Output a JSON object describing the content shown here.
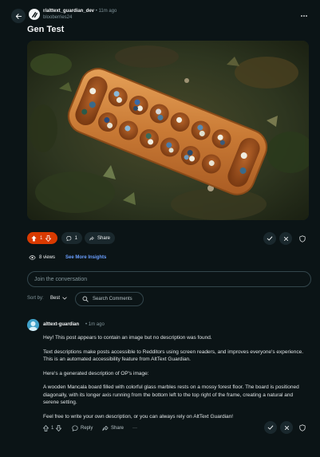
{
  "header": {
    "subreddit": "r/alttext_guardian_dev",
    "time": "• 11m ago",
    "author": "blooberries24"
  },
  "post": {
    "title": "Gen Test",
    "image_alt": "Wooden Mancala board with glass marbles on a mossy forest floor"
  },
  "post_actions": {
    "votes": "1",
    "comments": "1",
    "share_label": "Share"
  },
  "stats": {
    "views": "8 views",
    "insights_label": "See More Insights"
  },
  "join": {
    "placeholder": "Join the conversation"
  },
  "sort": {
    "label": "Sort by:",
    "value": "Best",
    "search_label": "Search Comments"
  },
  "comment": {
    "user": "alttext-guardian",
    "time": "• 1m ago",
    "paragraphs": [
      "Hey! This post appears to contain an image but no description was found.",
      "Text descriptions make posts accessible to Redditors using screen readers, and improves everyone's experience. This is an automated accessibility feature from AltText Guardian.",
      "Here's a generated description of OP's image:",
      "A wooden Mancala board filled with colorful glass marbles rests on a mossy forest floor. The board is positioned diagonally, with its longer axis running from the bottom left to the top right of the frame, creating a natural and serene setting.",
      "Feel free to write your own description, or you can always rely on AltText Guardian!"
    ],
    "votes": "1",
    "reply_label": "Reply",
    "share_label": "Share",
    "more_label": "···"
  },
  "colors": {
    "background": "#0b1416",
    "upvote_active": "#d93a00",
    "link": "#6a9fff"
  }
}
